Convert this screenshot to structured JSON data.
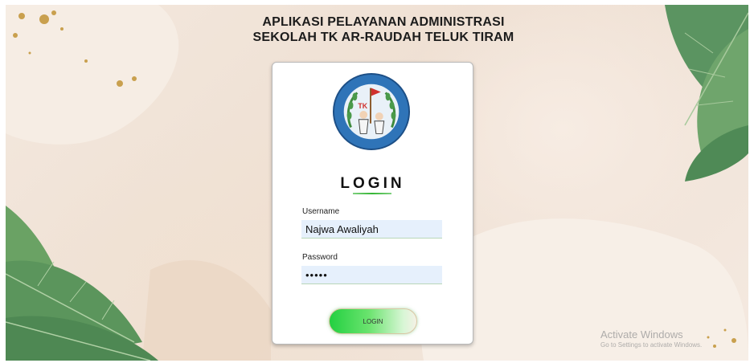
{
  "header": {
    "title_line1": "APLIKASI PELAYANAN ADMINISTRASI",
    "title_line2": "SEKOLAH TK AR-RAUDAH TELUK TIRAM"
  },
  "login_card": {
    "logo_icon": "tk-school-emblem-icon",
    "logo_text": "TK",
    "heading": "LOGIN",
    "username": {
      "label": "Username",
      "value": "Najwa Awaliyah"
    },
    "password": {
      "label": "Password",
      "value": "•••••"
    },
    "button_label": "LOGIN"
  },
  "watermark": {
    "title": "Activate Windows",
    "subtitle": "Go to Settings to activate Windows."
  },
  "colors": {
    "background": "#f1e5da",
    "leaf": "#5f9a5e",
    "button_green": "#23d041",
    "input_bg": "#e6f0fc",
    "emblem_blue": "#2f74b8"
  }
}
